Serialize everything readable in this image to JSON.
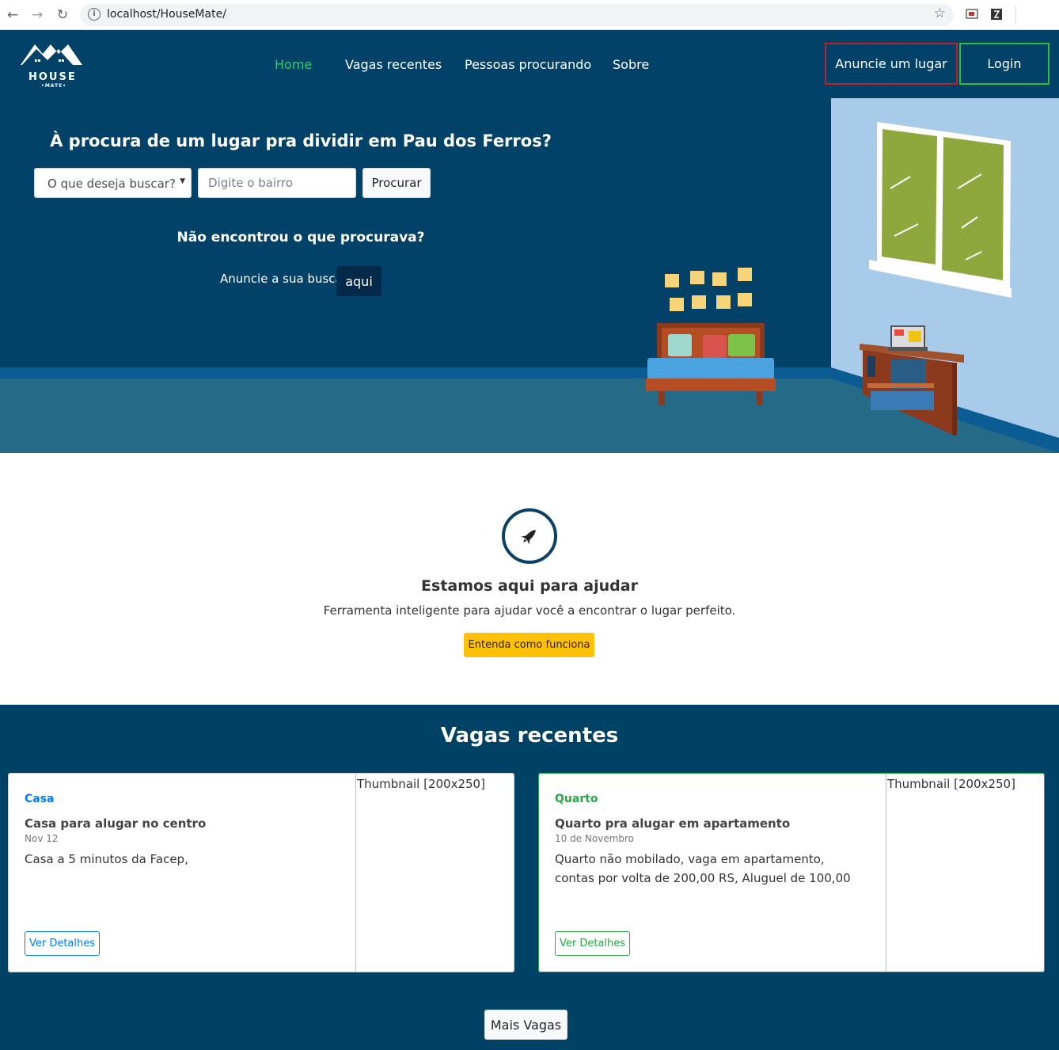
{
  "browser": {
    "url": "localhost/HouseMate/"
  },
  "brand": {
    "logo_text": "HOUSE",
    "logo_sub": "•MATE•"
  },
  "nav": {
    "items": [
      {
        "label": "Home",
        "active": true
      },
      {
        "label": "Vagas recentes",
        "active": false
      },
      {
        "label": "Pessoas procurando",
        "active": false
      },
      {
        "label": "Sobre",
        "active": false
      }
    ],
    "anuncie_label": "Anuncie um lugar",
    "login_label": "Login"
  },
  "hero": {
    "title": "À procura de um lugar pra dividir em Pau dos Ferros?",
    "select_value": "O que deseja buscar?",
    "bairro_placeholder": "Digite o bairro",
    "procurar_label": "Procurar",
    "not_found_title": "Não encontrou o que procurava?",
    "anuncie_text": "Anuncie a sua busca",
    "aqui_label": "aqui"
  },
  "help": {
    "title": "Estamos aqui para ajudar",
    "description": "Ferramenta inteligente para ajudar você a encontrar o lugar perfeito.",
    "button_label": "Entenda como funciona"
  },
  "vagas": {
    "title": "Vagas recentes",
    "cards": [
      {
        "category": "Casa",
        "title": "Casa para alugar no centro",
        "date": "Nov 12",
        "description": "Casa a 5 minutos da Facep,",
        "button_label": "Ver Detalhes",
        "thumbnail_alt": "Thumbnail [200x250]",
        "color": "#007bff"
      },
      {
        "category": "Quarto",
        "title": "Quarto pra alugar em apartamento",
        "date": "10 de Novembro",
        "description": "Quarto não mobilado, vaga em apartamento, contas por volta de 200,00 RS, Aluguel de 100,00",
        "button_label": "Ver Detalhes",
        "thumbnail_alt": "Thumbnail [200x250]",
        "color": "#28a745"
      }
    ],
    "more_label": "Mais Vagas"
  },
  "colors": {
    "navy": "#024268",
    "active_nav": "#2ecc71",
    "anuncie_border": "#c0202b",
    "login_border": "#2ebc3b",
    "cta_yellow": "#ffc107"
  }
}
